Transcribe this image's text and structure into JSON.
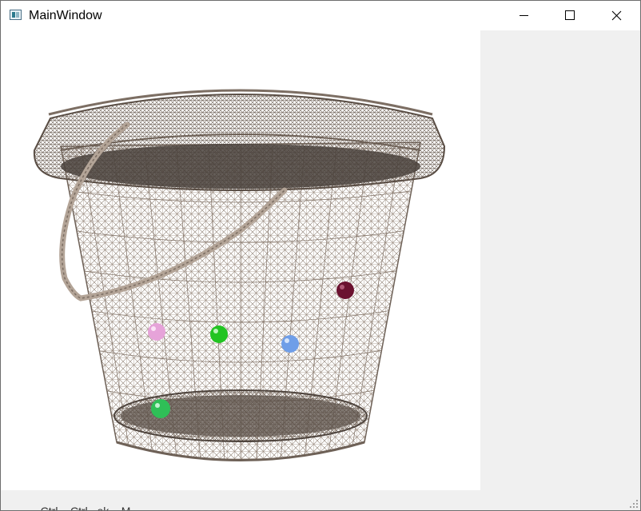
{
  "window": {
    "title": "MainWindow",
    "controls": {
      "minimize": "minimize-icon",
      "maximize": "maximize-icon",
      "close": "close-icon"
    }
  },
  "viewport": {
    "background": "#ffffff",
    "model": "bucket-wireframe",
    "wire_color": "#8a7a6d",
    "rim_color": "#5a4e45",
    "handle_color": "#b3a497",
    "balls": [
      {
        "name": "ball-dark-red",
        "color": "#6b1230"
      },
      {
        "name": "ball-pink",
        "color": "#e6a3d9"
      },
      {
        "name": "ball-green",
        "color": "#22c422"
      },
      {
        "name": "ball-blue",
        "color": "#6f9ee8"
      },
      {
        "name": "ball-lower-green",
        "color": "#2fbf57"
      }
    ]
  },
  "statusbar": {
    "text": "...Ctrl... Ctrl...ok  ...M..."
  }
}
